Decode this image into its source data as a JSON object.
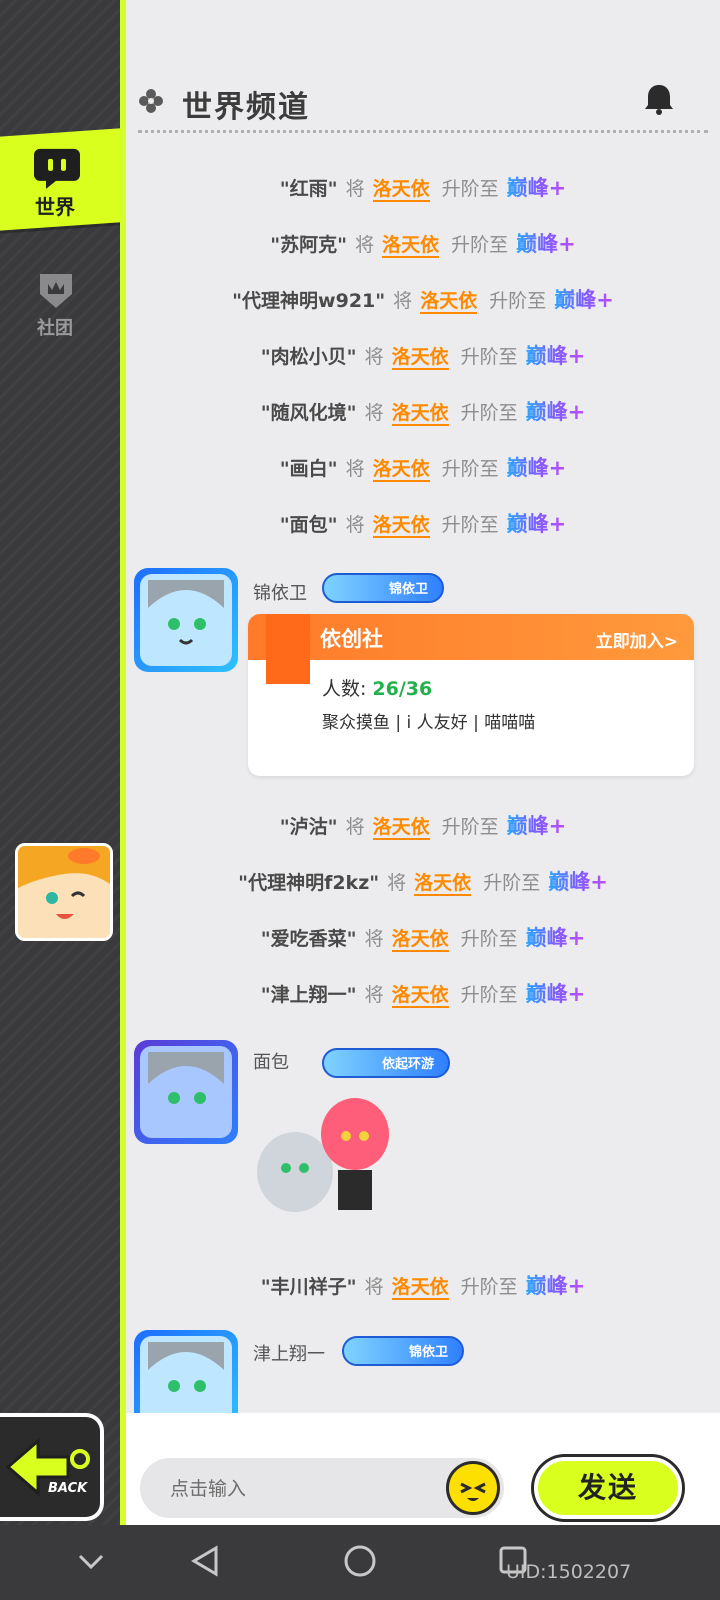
{
  "header": {
    "title": "世界频道"
  },
  "sidebar": {
    "tabs": [
      {
        "label": "世界"
      },
      {
        "label": "社团"
      }
    ],
    "back_label": "BACK"
  },
  "system_messages": [
    {
      "name": "\"红雨\"",
      "verb": "将",
      "hero": "洛天依",
      "action": "升阶至",
      "rank": "巅峰+"
    },
    {
      "name": "\"苏阿克\"",
      "verb": "将",
      "hero": "洛天依",
      "action": "升阶至",
      "rank": "巅峰+"
    },
    {
      "name": "\"代理神明w921\"",
      "verb": "将",
      "hero": "洛天依",
      "action": "升阶至",
      "rank": "巅峰+"
    },
    {
      "name": "\"肉松小贝\"",
      "verb": "将",
      "hero": "洛天依",
      "action": "升阶至",
      "rank": "巅峰+"
    },
    {
      "name": "\"随风化境\"",
      "verb": "将",
      "hero": "洛天依",
      "action": "升阶至",
      "rank": "巅峰+"
    },
    {
      "name": "\"画白\"",
      "verb": "将",
      "hero": "洛天依",
      "action": "升阶至",
      "rank": "巅峰+"
    },
    {
      "name": "\"面包\"",
      "verb": "将",
      "hero": "洛天依",
      "action": "升阶至",
      "rank": "巅峰+"
    },
    {
      "name": "\"泸沽\"",
      "verb": "将",
      "hero": "洛天依",
      "action": "升阶至",
      "rank": "巅峰+"
    },
    {
      "name": "\"代理神明f2kz\"",
      "verb": "将",
      "hero": "洛天依",
      "action": "升阶至",
      "rank": "巅峰+"
    },
    {
      "name": "\"爱吃香菜\"",
      "verb": "将",
      "hero": "洛天依",
      "action": "升阶至",
      "rank": "巅峰+"
    },
    {
      "name": "\"津上翔一\"",
      "verb": "将",
      "hero": "洛天依",
      "action": "升阶至",
      "rank": "巅峰+"
    },
    {
      "name": "\"丰川祥子\"",
      "verb": "将",
      "hero": "洛天依",
      "action": "升阶至",
      "rank": "巅峰+"
    }
  ],
  "user_messages": [
    {
      "name": "锦依卫",
      "badge": "锦依卫"
    },
    {
      "name": "面包",
      "badge": "依起环游"
    },
    {
      "name": "津上翔一",
      "badge": "锦依卫"
    }
  ],
  "club_card": {
    "name": "依创社",
    "join_label": "立即加入>",
    "members_label": "人数:",
    "members_count": "26/36",
    "description": "聚众摸鱼 | i 人友好 | 喵喵喵"
  },
  "input": {
    "placeholder": "点击输入",
    "send_label": "发送"
  },
  "footer": {
    "uid": "UID:1502207"
  },
  "colors": {
    "accent": "#d9ff1f",
    "hero": "#ff8a00",
    "club_header": "#ff7a2a",
    "members": "#23b14d"
  }
}
